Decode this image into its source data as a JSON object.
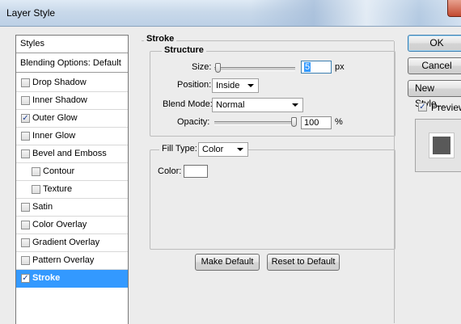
{
  "window": {
    "title": "Layer Style"
  },
  "styles_list": {
    "header": "Styles",
    "blending": "Blending Options: Default",
    "items": [
      {
        "label": "Drop Shadow",
        "checked": false,
        "indent": false,
        "selected": false
      },
      {
        "label": "Inner Shadow",
        "checked": false,
        "indent": false,
        "selected": false
      },
      {
        "label": "Outer Glow",
        "checked": true,
        "indent": false,
        "selected": false
      },
      {
        "label": "Inner Glow",
        "checked": false,
        "indent": false,
        "selected": false
      },
      {
        "label": "Bevel and Emboss",
        "checked": false,
        "indent": false,
        "selected": false
      },
      {
        "label": "Contour",
        "checked": false,
        "indent": true,
        "selected": false
      },
      {
        "label": "Texture",
        "checked": false,
        "indent": true,
        "selected": false
      },
      {
        "label": "Satin",
        "checked": false,
        "indent": false,
        "selected": false
      },
      {
        "label": "Color Overlay",
        "checked": false,
        "indent": false,
        "selected": false
      },
      {
        "label": "Gradient Overlay",
        "checked": false,
        "indent": false,
        "selected": false
      },
      {
        "label": "Pattern Overlay",
        "checked": false,
        "indent": false,
        "selected": false
      },
      {
        "label": "Stroke",
        "checked": true,
        "indent": false,
        "selected": true
      }
    ]
  },
  "stroke": {
    "section_title": "Stroke",
    "structure_title": "Structure",
    "size_label": "Size:",
    "size_value": "5",
    "size_unit": "px",
    "size_slider_fraction": 0.02,
    "position_label": "Position:",
    "position_value": "Inside",
    "blend_mode_label": "Blend Mode:",
    "blend_mode_value": "Normal",
    "opacity_label": "Opacity:",
    "opacity_value": "100",
    "opacity_unit": "%",
    "opacity_slider_fraction": 1.0,
    "fill_type_label": "Fill Type:",
    "fill_type_value": "Color",
    "color_label": "Color:",
    "color_swatch": "#ffffff",
    "make_default_label": "Make Default",
    "reset_default_label": "Reset to Default"
  },
  "actions": {
    "ok_label": "OK",
    "cancel_label": "Cancel",
    "new_style_label": "New Style...",
    "preview_label": "Preview",
    "preview_checked": true
  },
  "colors": {
    "selection": "#3399ff",
    "preview_swatch": "#595959"
  }
}
